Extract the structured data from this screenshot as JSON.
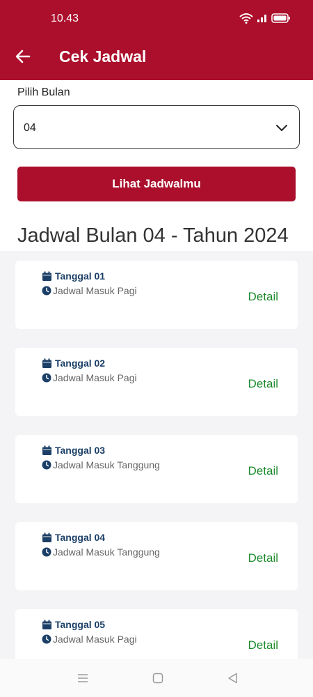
{
  "status_bar": {
    "time": "10.43"
  },
  "app_bar": {
    "title": "Cek Jadwal",
    "back_icon": "arrow-left-icon"
  },
  "form": {
    "month_label": "Pilih Bulan",
    "month_value": "04",
    "submit_label": "Lihat Jadwalmu"
  },
  "schedule": {
    "heading": "Jadwal Bulan 04 - Tahun 2024",
    "items": [
      {
        "date": "Tanggal 01",
        "shift": "Jadwal Masuk Pagi",
        "action": "Detail"
      },
      {
        "date": "Tanggal 02",
        "shift": "Jadwal Masuk Pagi",
        "action": "Detail"
      },
      {
        "date": "Tanggal 03",
        "shift": "Jadwal Masuk Tanggung",
        "action": "Detail"
      },
      {
        "date": "Tanggal 04",
        "shift": "Jadwal Masuk Tanggung",
        "action": "Detail"
      },
      {
        "date": "Tanggal 05",
        "shift": "Jadwal Masuk Pagi",
        "action": "Detail"
      }
    ]
  },
  "colors": {
    "brand": "#ab0f2b",
    "date_text": "#1b3f66",
    "detail_text": "#1c8a2c",
    "list_bg": "#f4f4f7"
  }
}
